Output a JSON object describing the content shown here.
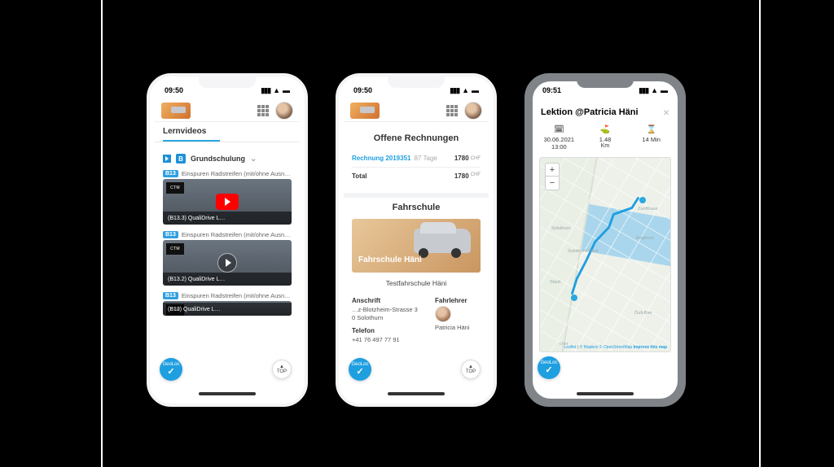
{
  "shared": {
    "top_label": "TOP",
    "badge_label": "GeoLoc"
  },
  "phone1": {
    "time": "09:50",
    "tab": "Lernvideos",
    "section_title": "Grundschulung",
    "videos": [
      {
        "tag": "B13",
        "title": "Einspuren Radstreifen (mit/ohne Ausnahmen)",
        "caption": "(B13.3) QualiDrive L…",
        "play_style": "youtube"
      },
      {
        "tag": "B13",
        "title": "Einspuren Radstreifen (mit/ohne Ausnahmen)",
        "caption": "(B13.2) QualiDrive L…",
        "play_style": "circle"
      },
      {
        "tag": "B13",
        "title": "Einspuren Radstreifen (mit/ohne Ausnahmen)",
        "caption": "(B13) QualiDrive L…",
        "play_style": ""
      }
    ]
  },
  "phone2": {
    "time": "09:50",
    "invoices_heading": "Offene Rechnungen",
    "invoice": {
      "label": "Rechnung 2019351",
      "days": "87 Tage",
      "amount": "1780",
      "currency": "CHF"
    },
    "total_label": "Total",
    "total_amount": "1780",
    "school_heading": "Fahrschule",
    "school_brand": "Fahrschule Häni",
    "school_name": "Testfahrschule Häni",
    "address_label": "Anschrift",
    "address_line1": "…z-Blotzheim-Strasse 3",
    "address_line2": "0 Solothurn",
    "phone_label": "Telefon",
    "phone_value": "+41 76 497 77 91",
    "instructor_label": "Fahrlehrer",
    "instructor_name": "Patricia Häni"
  },
  "phone3": {
    "time": "09:51",
    "lesson_title": "Lektion @Patricia Häni",
    "datetime_label": "30.06.2021 13:00",
    "distance_value": "1.48",
    "distance_unit": "Km",
    "duration": "14 Min",
    "map_labels": [
      "Solothurn",
      "Solothurn West",
      "Zunfthaus",
      "Stack",
      "Amphore",
      "Öufi-Bier",
      "cher"
    ],
    "attribution_leaflet": "Leaflet",
    "attribution_mapbox": "© Mapbox © OpenStreetMap",
    "attribution_improve": "Improve this map"
  }
}
